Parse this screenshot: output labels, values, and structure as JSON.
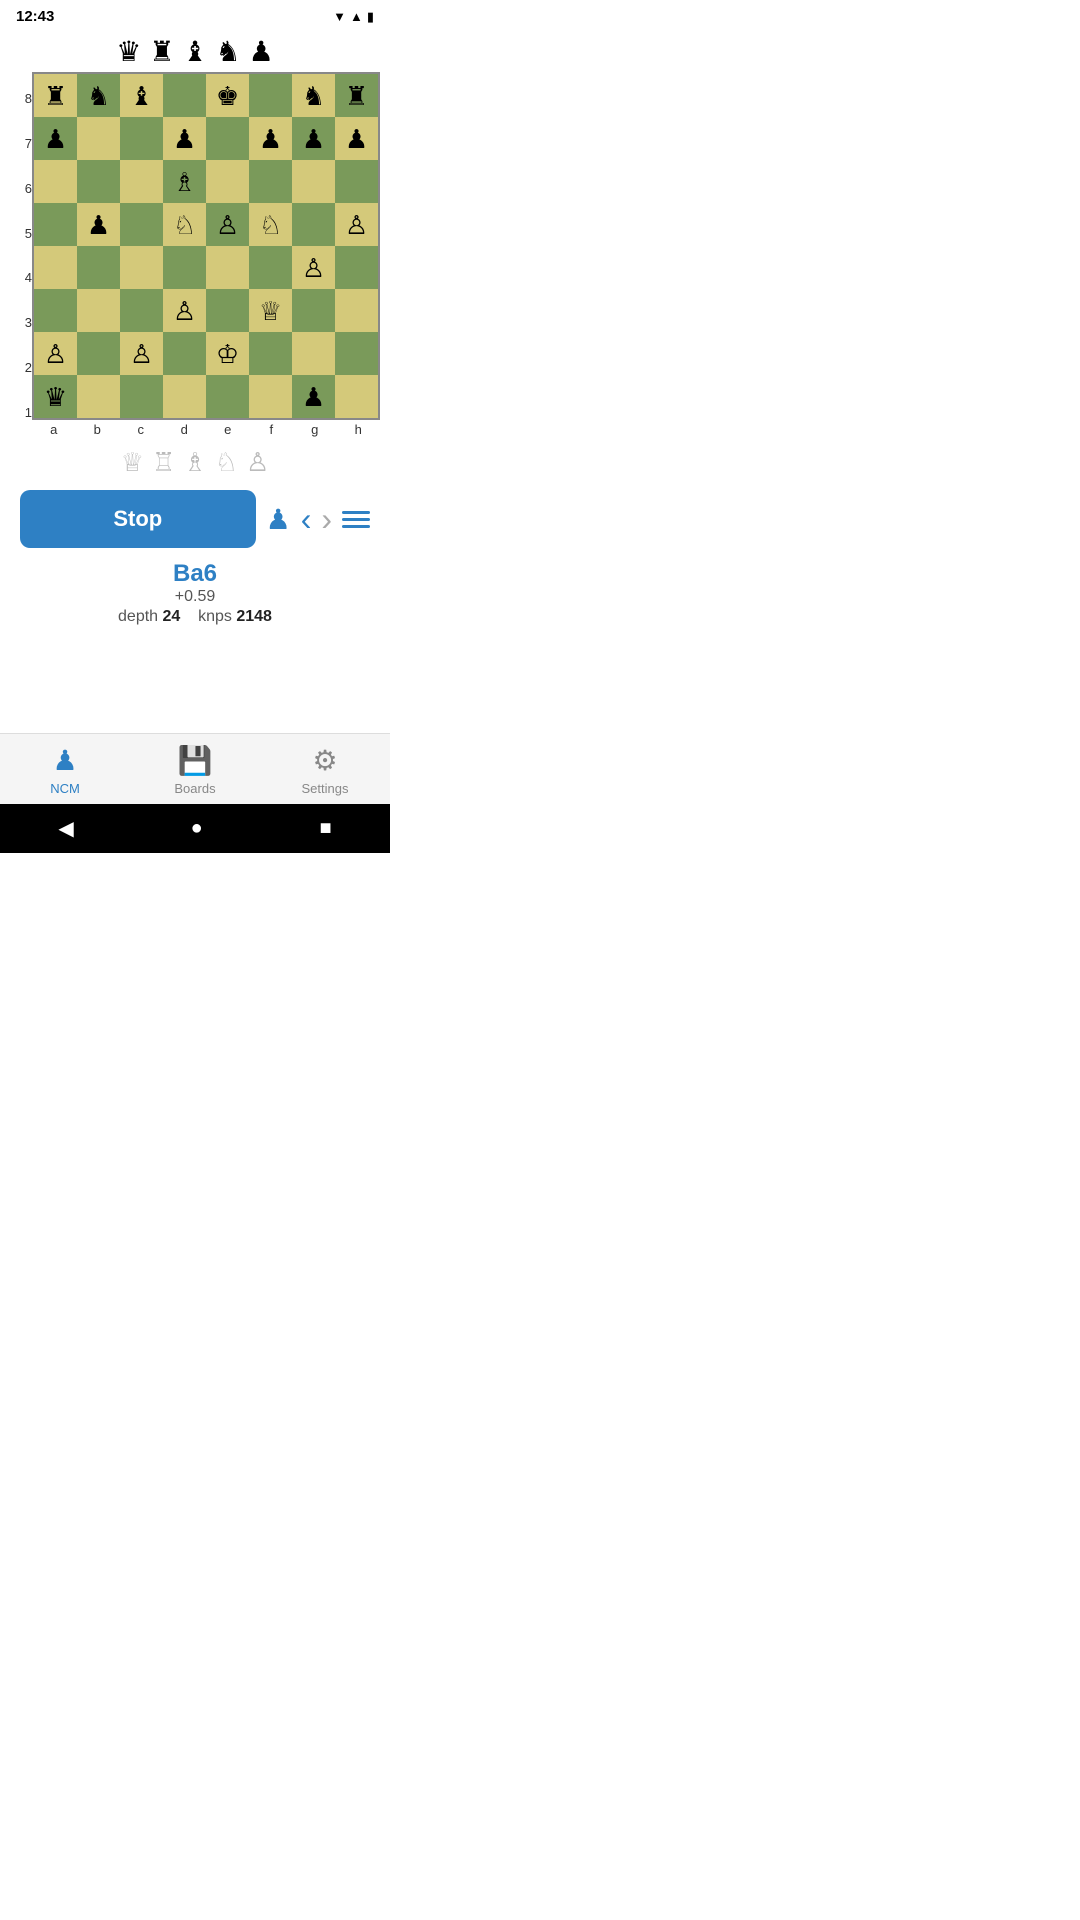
{
  "status": {
    "time": "12:43",
    "wifi": "▼",
    "signal": "▲",
    "battery": "🔋"
  },
  "captured_top": [
    "♛",
    "♜",
    "♝",
    "♞",
    "♟"
  ],
  "captured_bottom": [
    "♕",
    "♖",
    "♗",
    "♘",
    "♙"
  ],
  "board": {
    "ranks": [
      "8",
      "7",
      "6",
      "5",
      "4",
      "3",
      "2",
      "1"
    ],
    "files": [
      "a",
      "b",
      "c",
      "d",
      "e",
      "f",
      "g",
      "h"
    ],
    "pieces": {
      "a8": "♜",
      "b8": "♞",
      "c8": "♝",
      "e8": "♚",
      "g8": "♞",
      "h8": "♜",
      "a7": "♟",
      "d7": "♟",
      "f7": "♟",
      "g7": "♟",
      "h7": "♟",
      "d6": "♗",
      "b5": "♟",
      "d5": "♘",
      "e5": "♙",
      "f5": "♘",
      "h5": "♙",
      "g4": "♙",
      "d3": "♙",
      "f3": "♕",
      "a2": "♙",
      "c2": "♙",
      "e2": "♔",
      "a1": "♛",
      "g1": "♟"
    }
  },
  "controls": {
    "stop_label": "Stop",
    "pawn_icon": "♟",
    "nav_left": "‹",
    "nav_right": "›",
    "menu": "≡"
  },
  "analysis": {
    "move": "Ba6",
    "score": "+0.59",
    "depth_label": "depth",
    "depth_value": "24",
    "knps_label": "knps",
    "knps_value": "2148"
  },
  "nav": {
    "items": [
      {
        "id": "ncm",
        "label": "NCM",
        "active": true
      },
      {
        "id": "boards",
        "label": "Boards",
        "active": false
      },
      {
        "id": "settings",
        "label": "Settings",
        "active": false
      }
    ]
  },
  "sys_nav": {
    "back": "◀",
    "home": "●",
    "recent": "■"
  }
}
